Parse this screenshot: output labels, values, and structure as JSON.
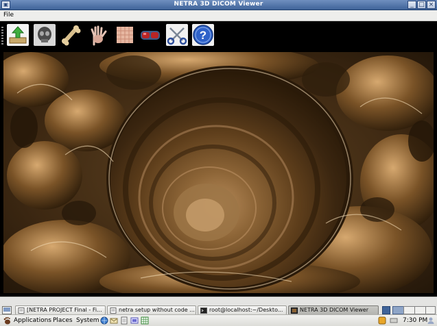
{
  "window": {
    "title": "NETRA 3D DICOM Viewer",
    "app_menu_glyph": "▣"
  },
  "window_controls": {
    "minimize": "_",
    "maximize": "□",
    "close": "×"
  },
  "menu": {
    "file": "File"
  },
  "toolbar": {
    "tools": [
      {
        "icon": "upload-open-icon"
      },
      {
        "icon": "skull-head-icon"
      },
      {
        "icon": "bone-icon"
      },
      {
        "icon": "hand-xray-icon"
      },
      {
        "icon": "skin-tissue-icon"
      },
      {
        "icon": "virtual-goggles-icon"
      },
      {
        "icon": "scissors-cut-icon"
      },
      {
        "icon": "help-question-icon",
        "glyph": "?"
      }
    ]
  },
  "viewer": {
    "content": "3D volume render of tubular structure (endoscopic view)",
    "tone": "#8b6233"
  },
  "taskbar": {
    "tasks": [
      {
        "label": "[NETRA PROJECT Final - Fi...",
        "active": false
      },
      {
        "label": "netra setup without code ...",
        "active": false
      },
      {
        "label": "root@localhost:~/Deskto...",
        "active": false
      },
      {
        "label": "NETRA 3D DICOM Viewer",
        "active": true
      }
    ],
    "workspaces": 4,
    "active_workspace": 1
  },
  "panel": {
    "applications": "Applications",
    "places": "Places",
    "system": "System",
    "clock": "7:30 PM"
  },
  "colors": {
    "titlebar": "#4f70a6",
    "toolbar": "#000000",
    "panel": "#e4e4e2"
  }
}
